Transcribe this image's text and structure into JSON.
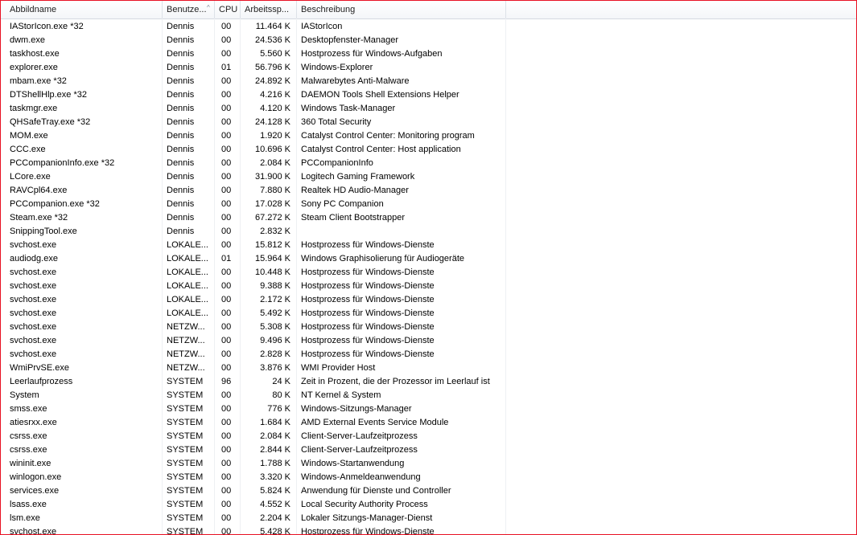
{
  "columns": {
    "name": "Abbildname",
    "user": "Benutze...",
    "cpu": "CPU",
    "memory": "Arbeitssp...",
    "description": "Beschreibung"
  },
  "processes": [
    {
      "name": "IAStorIcon.exe *32",
      "user": "Dennis",
      "cpu": "00",
      "mem": "11.464 K",
      "desc": "IAStorIcon"
    },
    {
      "name": "dwm.exe",
      "user": "Dennis",
      "cpu": "00",
      "mem": "24.536 K",
      "desc": "Desktopfenster-Manager"
    },
    {
      "name": "taskhost.exe",
      "user": "Dennis",
      "cpu": "00",
      "mem": "5.560 K",
      "desc": "Hostprozess für Windows-Aufgaben"
    },
    {
      "name": "explorer.exe",
      "user": "Dennis",
      "cpu": "01",
      "mem": "56.796 K",
      "desc": "Windows-Explorer"
    },
    {
      "name": "mbam.exe *32",
      "user": "Dennis",
      "cpu": "00",
      "mem": "24.892 K",
      "desc": "Malwarebytes Anti-Malware"
    },
    {
      "name": "DTShellHlp.exe *32",
      "user": "Dennis",
      "cpu": "00",
      "mem": "4.216 K",
      "desc": "DAEMON Tools Shell Extensions Helper"
    },
    {
      "name": "taskmgr.exe",
      "user": "Dennis",
      "cpu": "00",
      "mem": "4.120 K",
      "desc": "Windows Task-Manager"
    },
    {
      "name": "QHSafeTray.exe *32",
      "user": "Dennis",
      "cpu": "00",
      "mem": "24.128 K",
      "desc": "360 Total Security"
    },
    {
      "name": "MOM.exe",
      "user": "Dennis",
      "cpu": "00",
      "mem": "1.920 K",
      "desc": "Catalyst Control Center: Monitoring program"
    },
    {
      "name": "CCC.exe",
      "user": "Dennis",
      "cpu": "00",
      "mem": "10.696 K",
      "desc": "Catalyst Control Center: Host application"
    },
    {
      "name": "PCCompanionInfo.exe *32",
      "user": "Dennis",
      "cpu": "00",
      "mem": "2.084 K",
      "desc": "PCCompanionInfo"
    },
    {
      "name": "LCore.exe",
      "user": "Dennis",
      "cpu": "00",
      "mem": "31.900 K",
      "desc": "Logitech Gaming Framework"
    },
    {
      "name": "RAVCpl64.exe",
      "user": "Dennis",
      "cpu": "00",
      "mem": "7.880 K",
      "desc": "Realtek HD Audio-Manager"
    },
    {
      "name": "PCCompanion.exe *32",
      "user": "Dennis",
      "cpu": "00",
      "mem": "17.028 K",
      "desc": "Sony PC Companion"
    },
    {
      "name": "Steam.exe *32",
      "user": "Dennis",
      "cpu": "00",
      "mem": "67.272 K",
      "desc": "Steam Client Bootstrapper"
    },
    {
      "name": "SnippingTool.exe",
      "user": "Dennis",
      "cpu": "00",
      "mem": "2.832 K",
      "desc": ""
    },
    {
      "name": "svchost.exe",
      "user": "LOKALE...",
      "cpu": "00",
      "mem": "15.812 K",
      "desc": "Hostprozess für Windows-Dienste"
    },
    {
      "name": "audiodg.exe",
      "user": "LOKALE...",
      "cpu": "01",
      "mem": "15.964 K",
      "desc": "Windows Graphisolierung für Audiogeräte"
    },
    {
      "name": "svchost.exe",
      "user": "LOKALE...",
      "cpu": "00",
      "mem": "10.448 K",
      "desc": "Hostprozess für Windows-Dienste"
    },
    {
      "name": "svchost.exe",
      "user": "LOKALE...",
      "cpu": "00",
      "mem": "9.388 K",
      "desc": "Hostprozess für Windows-Dienste"
    },
    {
      "name": "svchost.exe",
      "user": "LOKALE...",
      "cpu": "00",
      "mem": "2.172 K",
      "desc": "Hostprozess für Windows-Dienste"
    },
    {
      "name": "svchost.exe",
      "user": "LOKALE...",
      "cpu": "00",
      "mem": "5.492 K",
      "desc": "Hostprozess für Windows-Dienste"
    },
    {
      "name": "svchost.exe",
      "user": "NETZW...",
      "cpu": "00",
      "mem": "5.308 K",
      "desc": "Hostprozess für Windows-Dienste"
    },
    {
      "name": "svchost.exe",
      "user": "NETZW...",
      "cpu": "00",
      "mem": "9.496 K",
      "desc": "Hostprozess für Windows-Dienste"
    },
    {
      "name": "svchost.exe",
      "user": "NETZW...",
      "cpu": "00",
      "mem": "2.828 K",
      "desc": "Hostprozess für Windows-Dienste"
    },
    {
      "name": "WmiPrvSE.exe",
      "user": "NETZW...",
      "cpu": "00",
      "mem": "3.876 K",
      "desc": "WMI Provider Host"
    },
    {
      "name": "Leerlaufprozess",
      "user": "SYSTEM",
      "cpu": "96",
      "mem": "24 K",
      "desc": "Zeit in Prozent, die der Prozessor im Leerlauf ist"
    },
    {
      "name": "System",
      "user": "SYSTEM",
      "cpu": "00",
      "mem": "80 K",
      "desc": "NT Kernel & System"
    },
    {
      "name": "smss.exe",
      "user": "SYSTEM",
      "cpu": "00",
      "mem": "776 K",
      "desc": "Windows-Sitzungs-Manager"
    },
    {
      "name": "atiesrxx.exe",
      "user": "SYSTEM",
      "cpu": "00",
      "mem": "1.684 K",
      "desc": "AMD External Events Service Module"
    },
    {
      "name": "csrss.exe",
      "user": "SYSTEM",
      "cpu": "00",
      "mem": "2.084 K",
      "desc": "Client-Server-Laufzeitprozess"
    },
    {
      "name": "csrss.exe",
      "user": "SYSTEM",
      "cpu": "00",
      "mem": "2.844 K",
      "desc": "Client-Server-Laufzeitprozess"
    },
    {
      "name": "wininit.exe",
      "user": "SYSTEM",
      "cpu": "00",
      "mem": "1.788 K",
      "desc": "Windows-Startanwendung"
    },
    {
      "name": "winlogon.exe",
      "user": "SYSTEM",
      "cpu": "00",
      "mem": "3.320 K",
      "desc": "Windows-Anmeldeanwendung"
    },
    {
      "name": "services.exe",
      "user": "SYSTEM",
      "cpu": "00",
      "mem": "5.824 K",
      "desc": "Anwendung für Dienste und Controller"
    },
    {
      "name": "lsass.exe",
      "user": "SYSTEM",
      "cpu": "00",
      "mem": "4.552 K",
      "desc": "Local Security Authority Process"
    },
    {
      "name": "lsm.exe",
      "user": "SYSTEM",
      "cpu": "00",
      "mem": "2.204 K",
      "desc": "Lokaler Sitzungs-Manager-Dienst"
    },
    {
      "name": "svchost.exe",
      "user": "SYSTEM",
      "cpu": "00",
      "mem": "5.428 K",
      "desc": "Hostprozess für Windows-Dienste"
    }
  ]
}
